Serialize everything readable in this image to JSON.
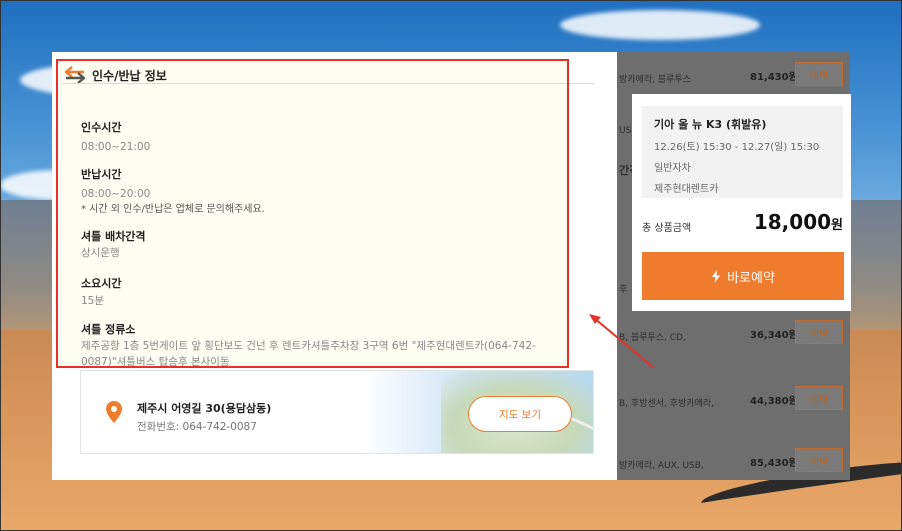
{
  "info_section": {
    "title": "인수/반납 정보",
    "pickup_label": "인수시간",
    "pickup_value": "08:00~21:00",
    "return_label": "반납시간",
    "return_value": "08:00~20:00",
    "return_note": "* 시간 외 인수/반납은 업체로 문의해주세요.",
    "shuttle_label": "셔틀 배차간격",
    "shuttle_value": "상시운행",
    "duration_label": "소요시간",
    "duration_value": "15분",
    "stop_label": "셔틀 정류소",
    "stop_value_line1": "제주공항 1층 5번게이트 앞 횡단보도 건넌 후 렌트카셔틀주차장 3구역 6번 \"제주현대렌트카(064-742-",
    "stop_value_line2": "0087)\"셔틀버스 탑승후 본사이동"
  },
  "map_card": {
    "address": "제주시 어영길 30(용담삼동)",
    "phone": "전화번호: 064-742-0087",
    "map_button": "지도 보기"
  },
  "summary": {
    "car_name": "기아 올 뉴 K3 (휘발유)",
    "period": "12.26(토) 15:30 - 12.27(일) 15:30",
    "car_class": "일반자차",
    "company": "제주현대렌트카",
    "total_label": "총 상품금액",
    "total_price": "18,000",
    "currency": "원",
    "book_button": "바로예약"
  },
  "list_rows": [
    {
      "tags": "방카메라, 블루투스",
      "price": "81,430원",
      "button": "예약"
    },
    {
      "tags": "USB",
      "price": "",
      "button": ""
    },
    {
      "tags": "B, 블루투스, CD,",
      "price": "36,340원",
      "button": "예약"
    },
    {
      "tags": "B, 후방센서, 후방카메라,",
      "price": "44,380원",
      "button": "예약"
    },
    {
      "tags": "방카메라, AUX, USB,",
      "price": "85,430원",
      "button": "예약"
    }
  ],
  "list_fragments": {
    "partial_text_a": "간격",
    "partial_text_b": "후"
  },
  "colors": {
    "accent": "#ef7b2c",
    "highlight_border": "#e53228"
  }
}
